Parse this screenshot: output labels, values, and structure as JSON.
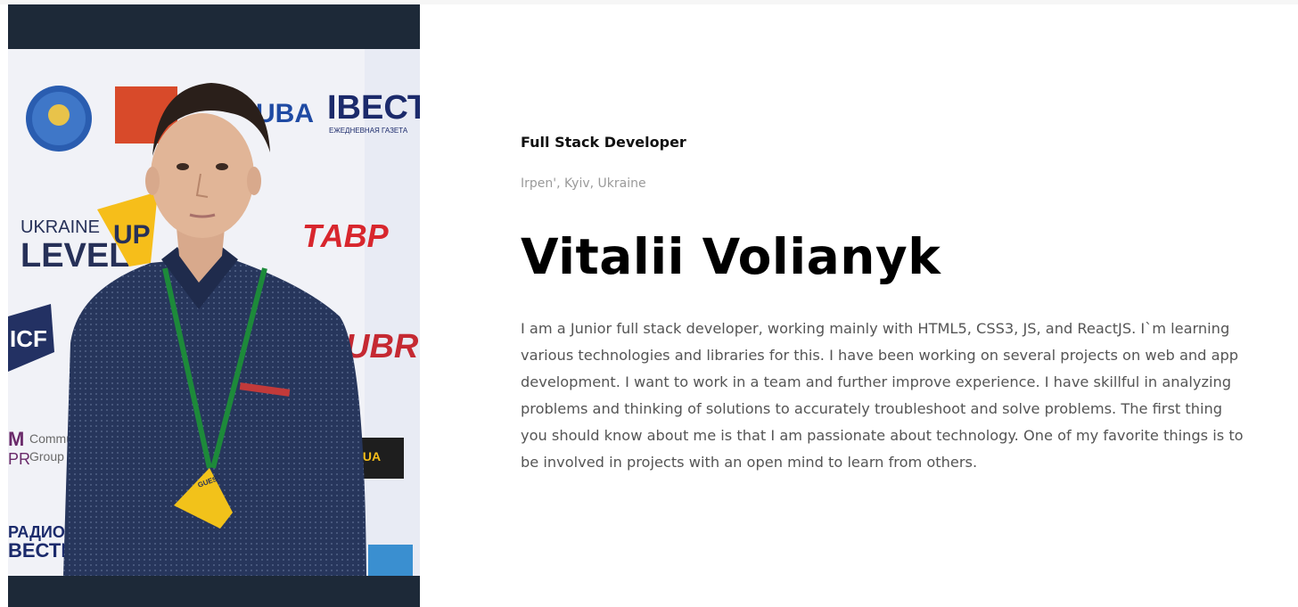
{
  "colors": {
    "photo_frame": "#1d2938",
    "heading": "#000000",
    "muted": "#9a9a9a",
    "body": "#555555"
  },
  "profile": {
    "role": "Full Stack Developer",
    "location": "Irpen', Kyiv, Ukraine",
    "name": "Vitalii Volianyk",
    "bio": "I am a Junior full stack developer, working mainly with HTML5, CSS3, JS, and ReactJS. I`m learning various technologies and libraries for this. I have been working on several projects on web and app development. I want to work in a team and further improve experience. I have skillful in analyzing problems and thinking of solutions to accurately troubleshoot and solve problems. The first thing you should know about me is that I am passionate about technology. One of my favorite things is to be involved in projects with an open mind to learn from others."
  },
  "photo_backdrop": {
    "logos": {
      "ukraine_level_up_top": "UKRAINE",
      "ukraine_level_up_level": "LEVEL",
      "ukraine_level_up_up": "UP",
      "vesti": "ІВЕСТИ",
      "vesti_sub": "ЕЖЕДНЕВНАЯ ГАЗЕТА",
      "taf": "ТАВР",
      "icf": "ICF",
      "ubr": "UBR",
      "uba": "UBA",
      "mpr_m": "M",
      "mpr_pr": "PR",
      "mpr_line1": "Commu",
      "mpr_line2": "Group",
      "ua": ".UA",
      "radio": "РАДИО",
      "radio_vesti": "ВЕСТИ",
      "badge": "GUEST"
    }
  }
}
